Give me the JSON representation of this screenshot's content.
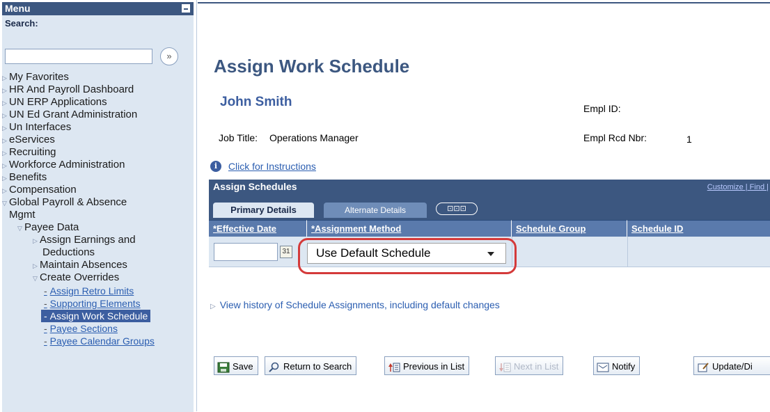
{
  "menu": {
    "title": "Menu",
    "search_label": "Search:",
    "search_value": "",
    "search_go": "»",
    "items": [
      {
        "label": "My Favorites",
        "type": "collapsed"
      },
      {
        "label": "HR And Payroll Dashboard",
        "type": "collapsed"
      },
      {
        "label": "UN ERP Applications",
        "type": "collapsed"
      },
      {
        "label": "UN Ed Grant Administration",
        "type": "collapsed"
      },
      {
        "label": "Un Interfaces",
        "type": "collapsed"
      },
      {
        "label": "eServices",
        "type": "collapsed"
      },
      {
        "label": "Recruiting",
        "type": "collapsed"
      },
      {
        "label": "Workforce Administration",
        "type": "collapsed"
      },
      {
        "label": "Benefits",
        "type": "collapsed"
      },
      {
        "label": "Compensation",
        "type": "collapsed"
      },
      {
        "label": "Global Payroll & Absence",
        "type": "expanded"
      },
      {
        "label": "Mgmt",
        "type": "continuation"
      },
      {
        "label": "Payee Data",
        "type": "expanded"
      },
      {
        "label": "Assign Earnings and",
        "type": "collapsed"
      },
      {
        "label": "Deductions",
        "type": "continuation"
      },
      {
        "label": "Maintain Absences",
        "type": "collapsed"
      },
      {
        "label": "Create Overrides",
        "type": "expanded"
      },
      {
        "label": "Assign Retro Limits",
        "type": "link"
      },
      {
        "label": "Supporting Elements",
        "type": "link"
      },
      {
        "label": "Assign Work Schedule",
        "type": "selected"
      },
      {
        "label": "Payee Sections",
        "type": "link"
      },
      {
        "label": "Payee Calendar Groups",
        "type": "link"
      }
    ]
  },
  "page": {
    "title": "Assign Work Schedule",
    "employee_name": "John Smith",
    "empl_id_label": "Empl ID:",
    "empl_id_value": "",
    "job_title_label": "Job Title:",
    "job_title_value": "Operations Manager",
    "empl_rcd_label": "Empl Rcd Nbr:",
    "empl_rcd_value": "1",
    "instructions_link": "Click for Instructions",
    "history_link": "View history of Schedule Assignments, including default changes"
  },
  "grid": {
    "title": "Assign Schedules",
    "links": "Customize | Find |",
    "tabs": [
      "Primary Details",
      "Alternate Details",
      "⊡⊡⊡"
    ],
    "columns": [
      "*Effective Date",
      "*Assignment Method",
      "Schedule Group",
      "Schedule ID"
    ],
    "row": {
      "effective_date": "",
      "assignment_method": "Use Default Schedule",
      "schedule_group": "",
      "schedule_id": ""
    }
  },
  "toolbar": {
    "save": "Save",
    "return_to_search": "Return to Search",
    "previous_in_list": "Previous in List",
    "next_in_list": "Next in List",
    "notify": "Notify",
    "update_display": "Update/Di"
  },
  "colors": {
    "accent": "#3c5780",
    "menu_bg": "#dde7f2",
    "highlight_ring": "#d43a3a",
    "link": "#2a5db0"
  }
}
